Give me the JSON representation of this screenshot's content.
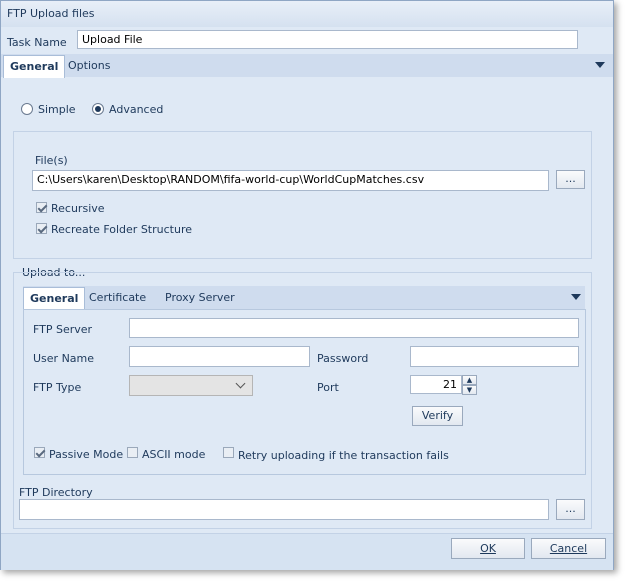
{
  "window": {
    "title": "FTP Upload files"
  },
  "task": {
    "label": "Task Name",
    "value": "Upload File"
  },
  "main_tabs": [
    {
      "label": "General"
    },
    {
      "label": "Options"
    }
  ],
  "mode": {
    "simple": "Simple",
    "advanced": "Advanced",
    "selected": "Advanced"
  },
  "files": {
    "label": "File(s)",
    "path": "C:\\Users\\karen\\Desktop\\RANDOM\\fifa-world-cup\\WorldCupMatches.csv",
    "browse": "...",
    "recursive": {
      "label": "Recursive",
      "checked": true
    },
    "recreate": {
      "label": "Recreate Folder Structure",
      "checked": true
    }
  },
  "upload": {
    "group_label": "Upload to...",
    "tabs": [
      {
        "label": "General"
      },
      {
        "label": "Certificate"
      },
      {
        "label": "Proxy Server"
      }
    ],
    "ftp_server": {
      "label": "FTP Server",
      "value": ""
    },
    "user_name": {
      "label": "User Name",
      "value": ""
    },
    "password": {
      "label": "Password",
      "value": ""
    },
    "ftp_type": {
      "label": "FTP Type",
      "value": ""
    },
    "port": {
      "label": "Port",
      "value": "21"
    },
    "verify": "Verify",
    "passive": {
      "label": "Passive Mode",
      "checked": true
    },
    "ascii": {
      "label": "ASCII mode",
      "checked": false
    },
    "retry": {
      "label": "Retry uploading if the transaction fails",
      "checked": false
    }
  },
  "directory": {
    "label": "FTP Directory",
    "value": "",
    "browse": "..."
  },
  "footer": {
    "ok": "OK",
    "cancel": "Cancel"
  },
  "colors": {
    "accent": "#1e395b",
    "background": "#dfe9f5",
    "tab_strip": "#cfdcee"
  }
}
